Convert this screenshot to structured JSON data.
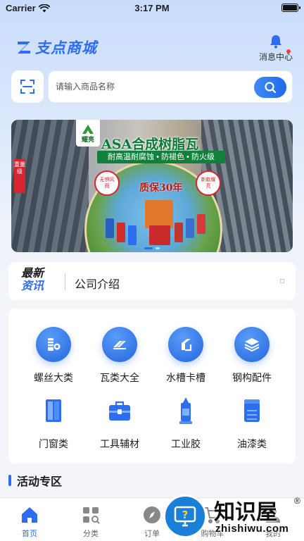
{
  "status_bar": {
    "carrier": "Carrier",
    "time": "3:17 PM"
  },
  "header": {
    "logo_text": "支点商城",
    "message_center": "消息中心"
  },
  "search": {
    "placeholder": "请输入商品名称",
    "value": ""
  },
  "banner": {
    "title": "ASA合成树脂瓦",
    "subtitle": "耐高温耐腐蚀 • 防褪色 • 防火级",
    "warranty": "质保30年",
    "logo_text": "耀亮",
    "badge": "重量级",
    "tag_left": "无惧风雨",
    "tag_right": "新款耀亮",
    "total_slides": 2,
    "active_slide": 1
  },
  "news": {
    "logo_line1": "最新",
    "logo_line2": "资讯",
    "headline": "公司介绍"
  },
  "categories": [
    {
      "label": "螺丝大类",
      "icon": "screw-icon"
    },
    {
      "label": "瓦类大全",
      "icon": "tile-icon"
    },
    {
      "label": "水槽卡槽",
      "icon": "gutter-icon"
    },
    {
      "label": "钢构配件",
      "icon": "layers-icon"
    },
    {
      "label": "门窗类",
      "icon": "door-window-icon"
    },
    {
      "label": "工具辅材",
      "icon": "toolbox-icon"
    },
    {
      "label": "工业胶",
      "icon": "glue-icon"
    },
    {
      "label": "油漆类",
      "icon": "paint-can-icon"
    }
  ],
  "activity": {
    "title": "活动专区"
  },
  "tabbar": [
    {
      "label": "首页",
      "icon": "home-icon",
      "active": true
    },
    {
      "label": "分类",
      "icon": "grid-icon",
      "active": false
    },
    {
      "label": "订单",
      "icon": "compass-icon",
      "active": false
    },
    {
      "label": "购物车",
      "icon": "cart-icon",
      "active": false
    },
    {
      "label": "我的",
      "icon": "user-icon",
      "active": false
    }
  ],
  "watermark": {
    "title": "知识屋",
    "reg": "®",
    "url": "zhishiwu.com"
  },
  "colors": {
    "accent": "#2f6df0",
    "badge_red": "#ff3b30",
    "brand_green": "#11803b"
  }
}
